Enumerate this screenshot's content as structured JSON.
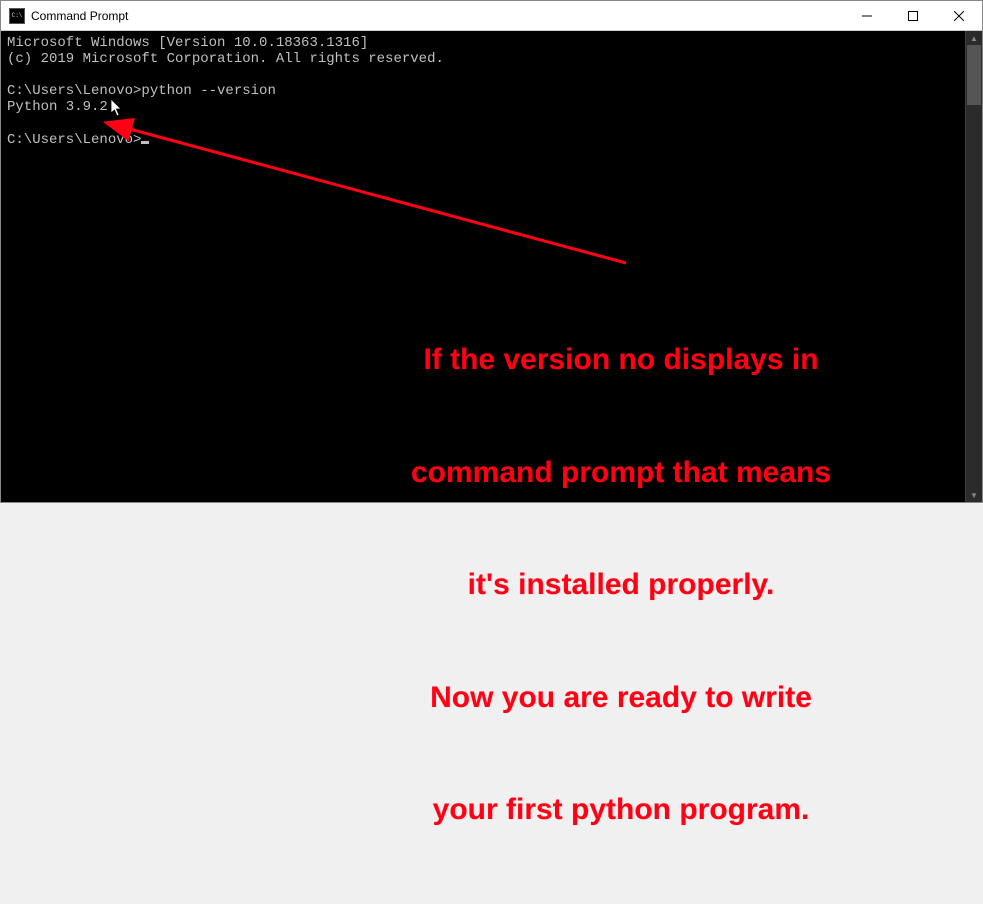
{
  "window": {
    "title": "Command Prompt",
    "icon_name": "cmd-icon"
  },
  "terminal": {
    "line1": "Microsoft Windows [Version 10.0.18363.1316]",
    "line2": "(c) 2019 Microsoft Corporation. All rights reserved.",
    "blank1": "",
    "prompt1_path": "C:\\Users\\Lenovo>",
    "prompt1_cmd": "python --version",
    "output1": "Python 3.9.2",
    "blank2": "",
    "prompt2_path": "C:\\Users\\Lenovo>"
  },
  "annotation": {
    "line1": "If the version no displays in",
    "line2": "command prompt that means",
    "line3": "it's installed properly.",
    "line4": "Now you are ready to write",
    "line5": "your first python program."
  },
  "colors": {
    "annotation_red": "#ff0015",
    "terminal_bg": "#000000",
    "terminal_fg": "#c0c0c0"
  }
}
